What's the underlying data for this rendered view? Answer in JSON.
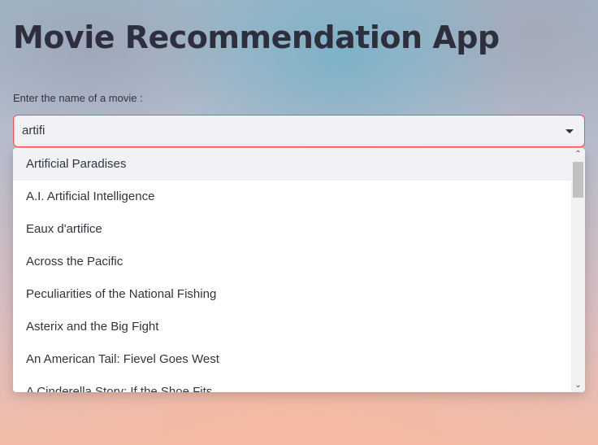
{
  "app": {
    "title": "Movie Recommendation App"
  },
  "movie_select": {
    "label": "Enter the name of a movie :",
    "value": "artifi",
    "dropdown_icon": "caret-down-icon",
    "options": [
      "Artificial Paradises",
      "A.I. Artificial Intelligence",
      "Eaux d'artifice",
      "Across the Pacific",
      "Peculiarities of the National Fishing",
      "Asterix and the Big Fight",
      "An American Tail: Fievel Goes West",
      "A Cinderella Story: If the Shoe Fits"
    ],
    "highlighted_option": "Artificial Paradises"
  },
  "scrollbar": {
    "up_icon": "chevron-up-icon",
    "down_icon": "chevron-down-icon"
  },
  "colors": {
    "accent_border": "#ff4b4b",
    "input_background": "#f0f2f6",
    "text": "#31333f",
    "title": "#2e2f3d"
  }
}
